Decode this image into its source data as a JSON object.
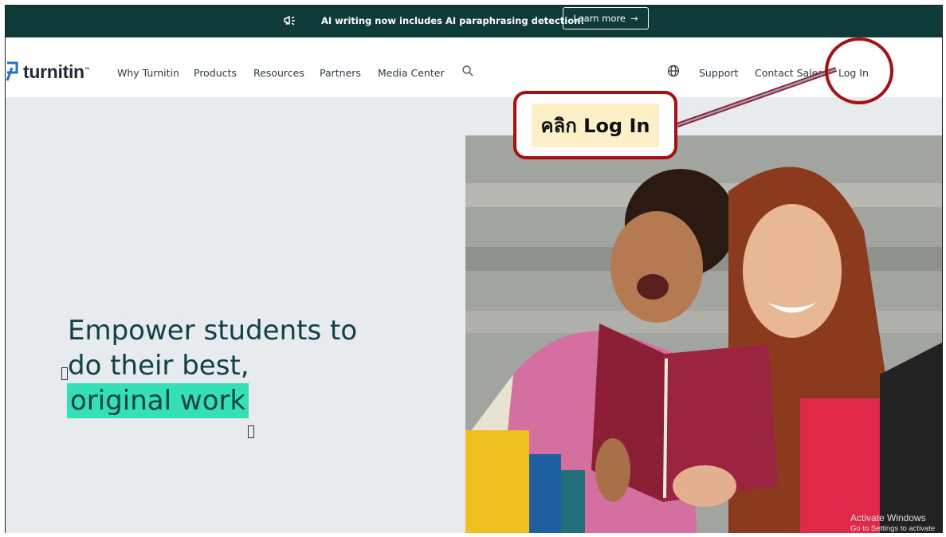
{
  "announcement": {
    "message": "AI writing now includes AI paraphrasing detection!",
    "button_label": "Learn more",
    "button_arrow": "→",
    "icon": "megaphone-icon"
  },
  "nav": {
    "logo_text": "turnitin",
    "logo_tm": "™",
    "links": [
      "Why Turnitin",
      "Products",
      "Resources",
      "Partners",
      "Media Center"
    ],
    "right_links": [
      "Support",
      "Contact Sales",
      "Log In"
    ],
    "icons": [
      "search-icon",
      "globe-icon"
    ]
  },
  "hero": {
    "headline_line1": "Empower students to",
    "headline_line2": "do their best,",
    "headline_highlight": "original work"
  },
  "annotation": {
    "callout_text": "คลิก Log In"
  },
  "watermark": {
    "line1": "Activate Windows",
    "line2": "Go to Settings to activate Windows."
  },
  "colors": {
    "announce_bg": "#0f3a3a",
    "headline": "#114146",
    "highlight": "#34e0b5",
    "annotation_red": "#a81010",
    "hero_bg": "#e7ebee"
  }
}
